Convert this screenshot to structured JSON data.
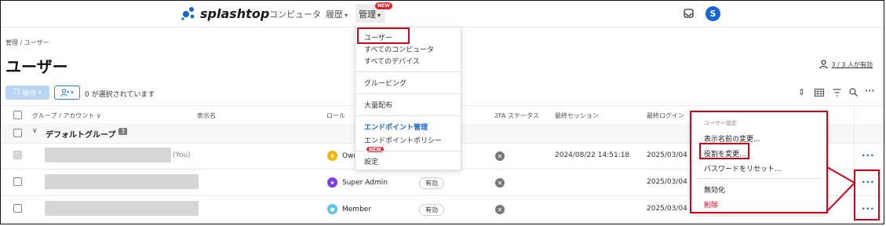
{
  "header": {
    "brand": "splashtop",
    "nav": [
      {
        "label": "コンピュータ"
      },
      {
        "label": "履歴"
      },
      {
        "label": "管理",
        "badge": "NEW"
      }
    ],
    "avatar_initial": "S"
  },
  "breadcrumb": "管理 / ユーザー",
  "page_title": "ユーザー",
  "seats": "3 / 3 人が有効",
  "toolbar": {
    "operations_label": "操作",
    "selected_count": "0 が選択されています"
  },
  "table": {
    "columns": [
      "グループ / アカウント",
      "表示名",
      "ロール",
      "2FA ステータス",
      "最終セッション",
      "最終ログイン"
    ],
    "group": {
      "name": "デフォルトグループ",
      "count": "3"
    },
    "rows": [
      {
        "suffix": "(You)",
        "role": "Own",
        "role_color": "#f5b400",
        "status": "",
        "last_session": "2024/08/22 14:51:18",
        "last_login": "2025/03/04 1"
      },
      {
        "suffix": "",
        "role": "Super Admin",
        "role_color": "#7b3fe4",
        "status": "有効",
        "last_session": "",
        "last_login": "2025/03/04 1"
      },
      {
        "suffix": "",
        "role": "Member",
        "role_color": "#5bc0f0",
        "status": "有効",
        "last_session": "",
        "last_login": "2025/03/04 1"
      }
    ]
  },
  "admin_menu": {
    "items": [
      {
        "label": "ユーザー"
      },
      {
        "label": "すべてのコンピュータ"
      },
      {
        "label": "すべてのデバイス"
      },
      {
        "label": "グルーピング"
      },
      {
        "label": "大量配布"
      },
      {
        "label": "エンドポイント管理"
      },
      {
        "label": "エンドポイントポリシー",
        "badge": "NEW"
      },
      {
        "label": "設定"
      }
    ]
  },
  "context_menu": {
    "section_title": "ユーザー設定",
    "items": [
      {
        "label": "表示名前の変更..."
      },
      {
        "label": "役割を変更..."
      },
      {
        "label": "パスワードをリセット..."
      },
      {
        "label": "無効化"
      },
      {
        "label": "削除"
      }
    ]
  },
  "colors": {
    "accent": "#1565d8",
    "highlight": "#d0021b",
    "danger": "#e0262b"
  }
}
